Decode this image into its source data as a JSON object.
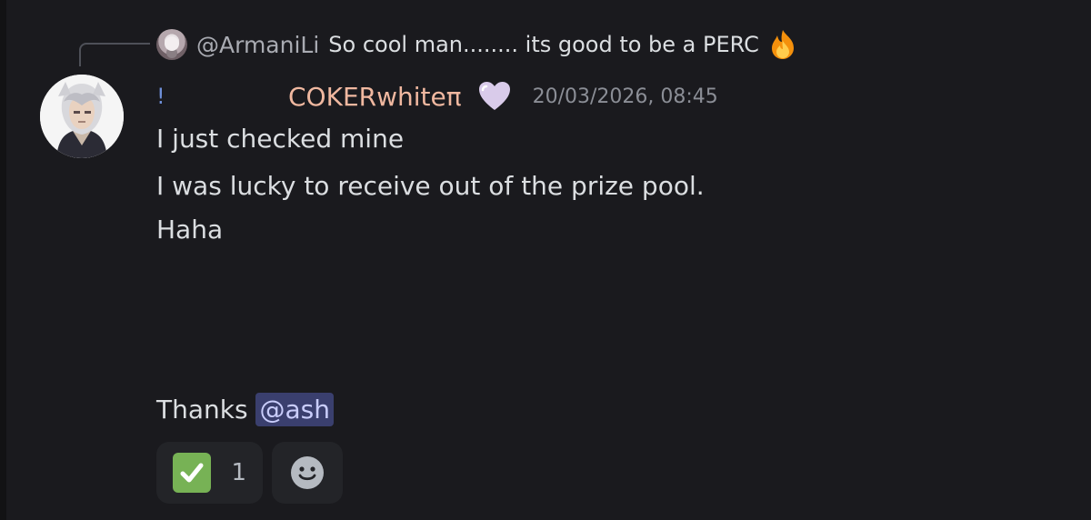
{
  "reply": {
    "username": "@ArmaniLi",
    "text": "So cool man........ its good to be a PERC",
    "emoji_icon": "fire-icon"
  },
  "message": {
    "role_glyph": "!",
    "username": "COKERwhiteπ",
    "username_color": "#f0b8a0",
    "badge_icon": "purple-heart-icon",
    "timestamp": "20/03/2026, 08:45",
    "lines": [
      "I just checked mine",
      "I was lucky to receive out of the prize pool.",
      "Haha"
    ],
    "closing_text": "Thanks",
    "mention": "@ash"
  },
  "reactions": [
    {
      "emoji_icon": "check-mark-button-icon",
      "count": "1"
    },
    {
      "emoji_icon": "add-reaction-smiley-icon"
    }
  ],
  "colors": {
    "background": "#1a1a1e",
    "mention_bg": "#3a3f6e",
    "reaction_bg": "#232428"
  }
}
